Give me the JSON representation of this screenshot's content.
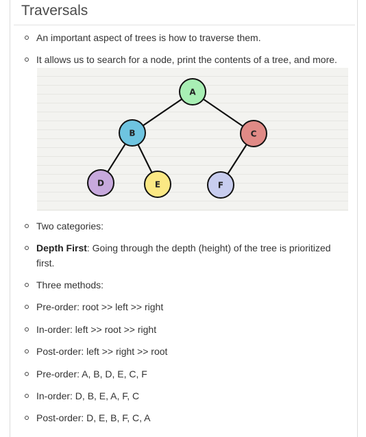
{
  "title": "Traversals",
  "bullets_top": [
    "An important aspect of trees is how to traverse them.",
    "It allows us to search for a node, print the contents of a tree, and more."
  ],
  "tree": {
    "nodes": [
      {
        "label": "A",
        "color": "#a8efb4"
      },
      {
        "label": "B",
        "color": "#6ec4e0"
      },
      {
        "label": "C",
        "color": "#e08a86"
      },
      {
        "label": "D",
        "color": "#c7a9dd"
      },
      {
        "label": "E",
        "color": "#fbe884"
      },
      {
        "label": "F",
        "color": "#c8cdef"
      }
    ],
    "edges": [
      [
        "A",
        "B"
      ],
      [
        "A",
        "C"
      ],
      [
        "B",
        "D"
      ],
      [
        "B",
        "E"
      ],
      [
        "C",
        "F"
      ]
    ]
  },
  "bullets_bottom": {
    "two_categories": "Two categories:",
    "depth_first_term": "Depth First",
    "depth_first_text": ": Going through the depth (height) of the tree is prioritized first.",
    "three_methods": "Three methods:",
    "preorder_rule": "Pre-order: root >> left >> right",
    "inorder_rule": "In-order: left >> root >> right",
    "postorder_rule": "Post-order: left >> right >> root",
    "preorder_result": "Pre-order: A, B, D, E, C, F",
    "inorder_result": "In-order: D, B, E, A, F, C",
    "postorder_result": "Post-order: D, E, B, F, C, A"
  }
}
